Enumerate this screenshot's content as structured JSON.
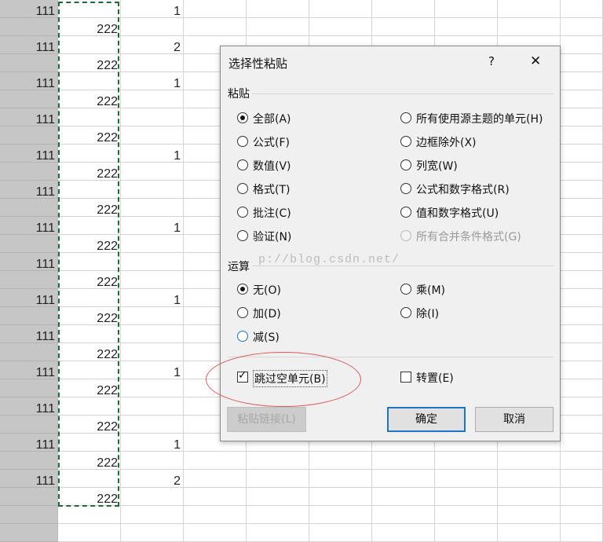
{
  "sheet": {
    "rows_a": [
      "111",
      "111",
      "111",
      "111",
      "111",
      "111",
      "111",
      "111",
      "111",
      "111",
      "111",
      "111",
      "111",
      "111"
    ],
    "rows_b": [
      "222",
      "222",
      "222",
      "222",
      "222",
      "222",
      "222",
      "222",
      "222",
      "222",
      "222",
      "222",
      "222",
      "222"
    ],
    "col_c_values": [
      "1",
      "2",
      "1",
      "1",
      "1",
      "1",
      "1",
      "1",
      "2"
    ]
  },
  "dialog": {
    "title": "选择性粘贴",
    "help_label": "?",
    "close_label": "✕",
    "paste_section": "粘贴",
    "paste_options_left": [
      "全部(A)",
      "公式(F)",
      "数值(V)",
      "格式(T)",
      "批注(C)",
      "验证(N)"
    ],
    "paste_options_right": [
      "所有使用源主题的单元(H)",
      "边框除外(X)",
      "列宽(W)",
      "公式和数字格式(R)",
      "值和数字格式(U)",
      "所有合并条件格式(G)"
    ],
    "operation_section": "运算",
    "operation_options_left": [
      "无(O)",
      "加(D)",
      "减(S)"
    ],
    "operation_options_right": [
      "乘(M)",
      "除(I)"
    ],
    "skip_blanks_label": "跳过空单元(B)",
    "transpose_label": "转置(E)",
    "paste_link_label": "粘贴链接(L)",
    "ok_label": "确定",
    "cancel_label": "取消",
    "watermark": "p://blog.csdn.net/"
  }
}
